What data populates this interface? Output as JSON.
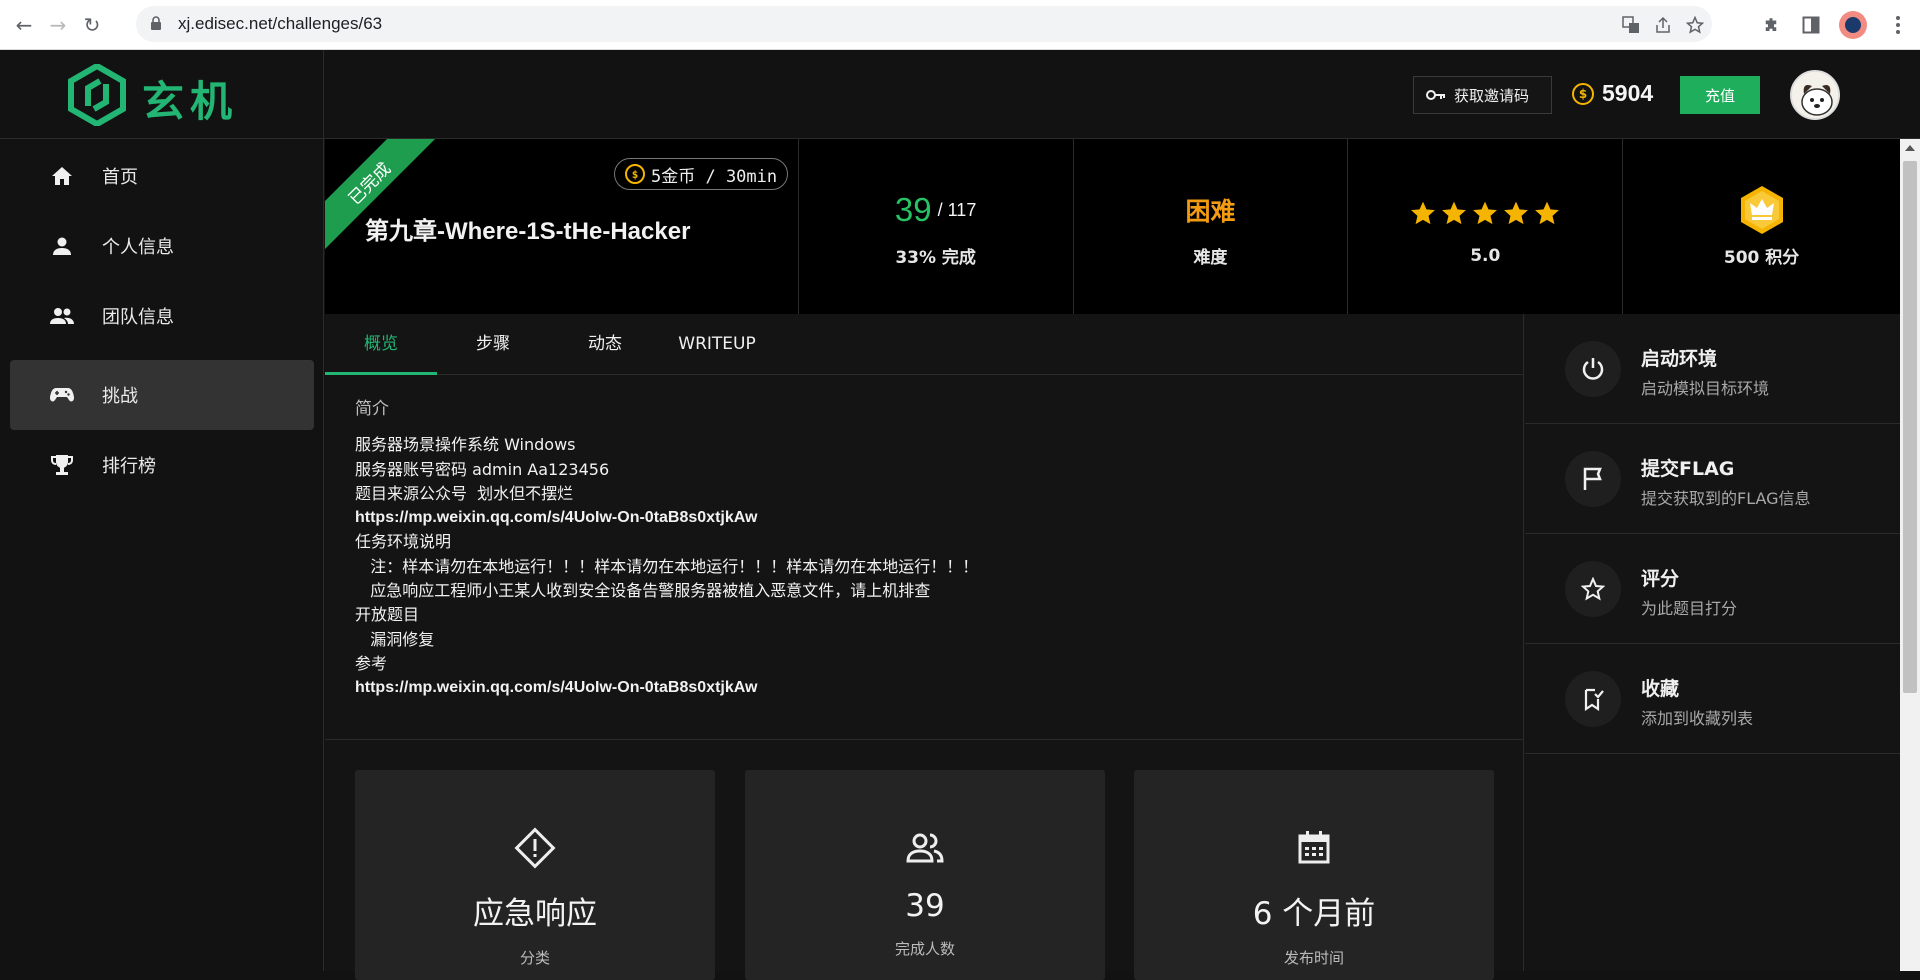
{
  "browser": {
    "url": "xj.edisec.net/challenges/63",
    "back_icon": "←",
    "forward_icon": "→",
    "reload_icon": "↻"
  },
  "header": {
    "logo_text": "玄机",
    "invite_label": "获取邀请码",
    "coin_symbol": "$",
    "coin_count": "5904",
    "recharge_label": "充值"
  },
  "sidebar": {
    "items": [
      {
        "label": "首页",
        "icon": "home-icon"
      },
      {
        "label": "个人信息",
        "icon": "person-icon"
      },
      {
        "label": "团队信息",
        "icon": "team-icon"
      },
      {
        "label": "挑战",
        "icon": "gamepad-icon"
      },
      {
        "label": "排行榜",
        "icon": "trophy-icon"
      }
    ],
    "active_index": 3
  },
  "challenge": {
    "status_ribbon": "已完成",
    "price": "5金币 / 30min",
    "title": "第九章-Where-1S-tHe-Hacker",
    "solved": "39",
    "total": "/ 117",
    "completion": "33% 完成",
    "difficulty": "困难",
    "difficulty_label": "难度",
    "rating": "5.0",
    "rating_stars": 5,
    "points": "500 积分"
  },
  "tabs": [
    "概览",
    "步骤",
    "动态",
    "WRITEUP"
  ],
  "description": {
    "label": "简介",
    "lines": [
      "服务器场景操作系统 Windows",
      "服务器账号密码 admin Aa123456",
      "题目来源公众号  划水但不摆烂",
      "https://mp.weixin.qq.com/s/4UoIw-On-0taB8s0xtjkAw",
      "任务环境说明",
      "   注：样本请勿在本地运行！！！样本请勿在本地运行！！！样本请勿在本地运行！！！",
      "   应急响应工程师小王某人收到安全设备告警服务器被植入恶意文件，请上机排查",
      "开放题目",
      "   漏洞修复",
      "参考",
      "https://mp.weixin.qq.com/s/4UoIw-On-0taB8s0xtjkAw"
    ]
  },
  "info_cards": [
    {
      "value": "应急响应",
      "caption": "分类",
      "icon": "alert-diamond-icon"
    },
    {
      "value": "39",
      "caption": "完成人数",
      "icon": "people-icon"
    },
    {
      "value": "6 个月前",
      "caption": "发布时间",
      "icon": "calendar-icon"
    }
  ],
  "actions": [
    {
      "title": "启动环境",
      "sub": "启动模拟目标环境",
      "icon": "power-icon"
    },
    {
      "title": "提交FLAG",
      "sub": "提交获取到的FLAG信息",
      "icon": "flag-icon"
    },
    {
      "title": "评分",
      "sub": "为此题目打分",
      "icon": "star-outline-icon"
    },
    {
      "title": "收藏",
      "sub": "添加到收藏列表",
      "icon": "bookmark-check-icon"
    }
  ],
  "colors": {
    "accent": "#22b573",
    "difficulty": "#f39c12",
    "star": "#f5b400",
    "solved": "#27c265"
  }
}
